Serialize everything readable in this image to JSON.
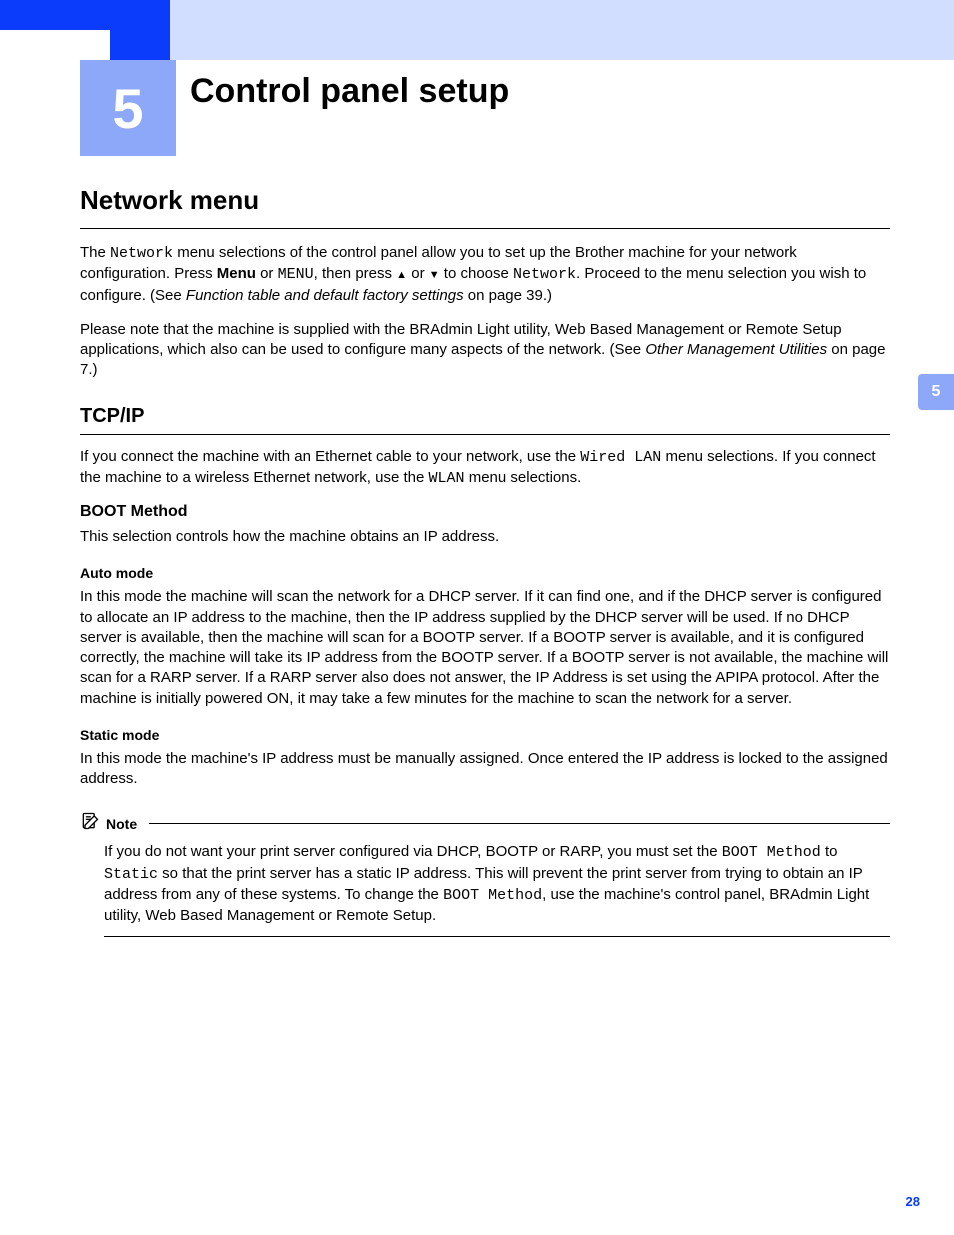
{
  "chapter": {
    "number": "5",
    "title": "Control panel setup"
  },
  "side_tab": "5",
  "page_number": "28",
  "section": {
    "heading": "Network menu",
    "p1_a": "The ",
    "p1_mono1": "Network",
    "p1_b": " menu selections of the control panel allow you to set up the Brother machine for your network configuration. Press ",
    "p1_bold1": "Menu",
    "p1_c": " or ",
    "p1_mono2": "MENU",
    "p1_d": ", then press ",
    "p1_arrow_up": "▲",
    "p1_e": " or ",
    "p1_arrow_down": "▼",
    "p1_f": " to choose ",
    "p1_mono3": "Network",
    "p1_g": ". Proceed to the menu selection you wish to configure. (See ",
    "p1_italic1": "Function table and default factory settings",
    "p1_h": " on page 39.)",
    "p2_a": "Please note that the machine is supplied with the BRAdmin Light utility, Web Based Management or Remote Setup applications, which also can be used to configure many aspects of the network. (See ",
    "p2_italic1": "Other Management Utilities",
    "p2_b": " on page 7.)"
  },
  "tcpip": {
    "heading": "TCP/IP",
    "p1_a": "If you connect the machine with an Ethernet cable to your network, use the ",
    "p1_mono1": "Wired LAN",
    "p1_b": " menu selections. If you connect the machine to a wireless Ethernet network, use the ",
    "p1_mono2": "WLAN",
    "p1_c": " menu selections."
  },
  "boot": {
    "heading": "BOOT Method",
    "p1": "This selection controls how the machine obtains an IP address."
  },
  "auto": {
    "heading": "Auto mode",
    "p1": "In this mode the machine will scan the network for a DHCP server. If it can find one, and if the DHCP server is configured to allocate an IP address to the machine, then the IP address supplied by the DHCP server will be used. If no DHCP server is available, then the machine will scan for a BOOTP server. If a BOOTP server is available, and it is configured correctly, the machine will take its IP address from the BOOTP server. If a BOOTP server is not available, the machine will scan for a RARP server. If a RARP server also does not answer, the IP Address is set using the APIPA protocol. After the machine is initially powered ON, it may take a few minutes for the machine to scan the network for a server."
  },
  "static": {
    "heading": "Static mode",
    "p1": "In this mode the machine's IP address must be manually assigned. Once entered the IP address is locked to the assigned address."
  },
  "note": {
    "label": "Note",
    "p1_a": "If you do not want your print server configured via DHCP, BOOTP or RARP, you must set the ",
    "p1_mono1": "BOOT Method",
    "p1_b": " to ",
    "p1_mono2": "Static",
    "p1_c": " so that the print server has a static IP address. This will prevent the print server from trying to obtain an IP address from any of these systems. To change the ",
    "p1_mono3": "BOOT Method",
    "p1_d": ", use the machine's control panel, BRAdmin Light utility, Web Based Management or Remote Setup."
  }
}
